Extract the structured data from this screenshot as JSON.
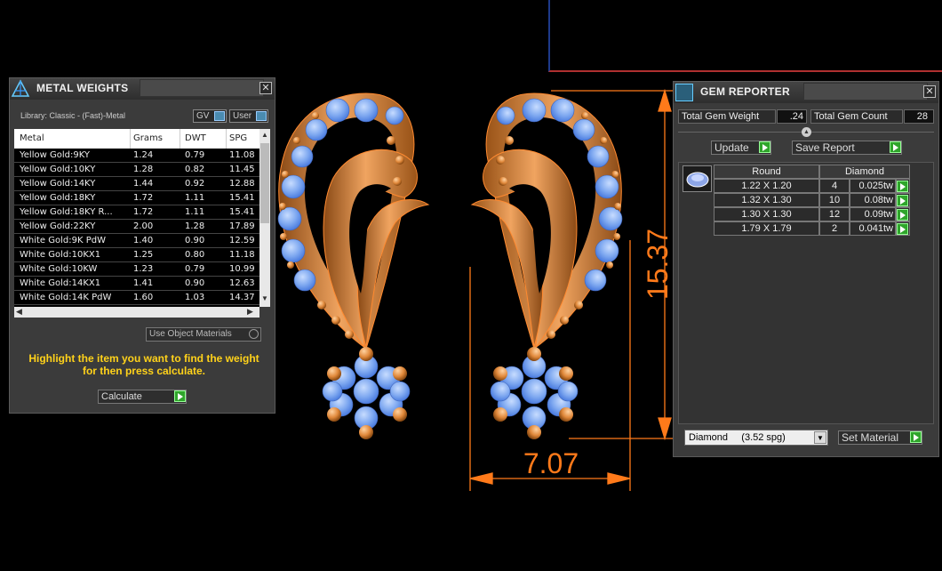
{
  "metal_weights": {
    "title": "METAL WEIGHTS",
    "library": "Library: Classic - (Fast)-Metal",
    "toggle_gv": "GV",
    "toggle_user": "User",
    "columns": [
      "Metal",
      "Grams",
      "DWT",
      "SPG"
    ],
    "rows": [
      [
        "Yellow Gold:9KY",
        "1.24",
        "0.79",
        "11.08"
      ],
      [
        "Yellow Gold:10KY",
        "1.28",
        "0.82",
        "11.45"
      ],
      [
        "Yellow Gold:14KY",
        "1.44",
        "0.92",
        "12.88"
      ],
      [
        "Yellow Gold:18KY",
        "1.72",
        "1.11",
        "15.41"
      ],
      [
        "Yellow Gold:18KY R...",
        "1.72",
        "1.11",
        "15.41"
      ],
      [
        "Yellow Gold:22KY",
        "2.00",
        "1.28",
        "17.89"
      ],
      [
        "White Gold:9K PdW",
        "1.40",
        "0.90",
        "12.59"
      ],
      [
        "White Gold:10KX1",
        "1.25",
        "0.80",
        "11.18"
      ],
      [
        "White Gold:10KW",
        "1.23",
        "0.79",
        "10.99"
      ],
      [
        "White Gold:14KX1",
        "1.41",
        "0.90",
        "12.63"
      ],
      [
        "White Gold:14K PdW",
        "1.60",
        "1.03",
        "14.37"
      ]
    ],
    "use_object_materials": "Use Object Materials",
    "hint": "Highlight the item you want to find the weight for then press calculate.",
    "calculate": "Calculate"
  },
  "gem_reporter": {
    "title": "GEM REPORTER",
    "total_weight_label": "Total Gem Weight",
    "total_weight_value": ".24",
    "total_count_label": "Total Gem Count",
    "total_count_value": "28",
    "update": "Update",
    "save_report": "Save Report",
    "col_shape": "Round",
    "col_material": "Diamond",
    "rows": [
      [
        "1.22 X 1.20",
        "4",
        "0.025tw"
      ],
      [
        "1.32 X 1.30",
        "10",
        "0.08tw"
      ],
      [
        "1.30 X 1.30",
        "12",
        "0.09tw"
      ],
      [
        "1.79 X 1.79",
        "2",
        "0.041tw"
      ]
    ],
    "material_select": "Diamond     (3.52 spg)",
    "set_material": "Set Material"
  },
  "dimensions": {
    "height": "15.37",
    "width": "7.07"
  },
  "colors": {
    "metal": "#e0883a",
    "gem": "#7ea8f0",
    "dimension": "#ff7a1a",
    "panel": "#3b3b3b"
  }
}
